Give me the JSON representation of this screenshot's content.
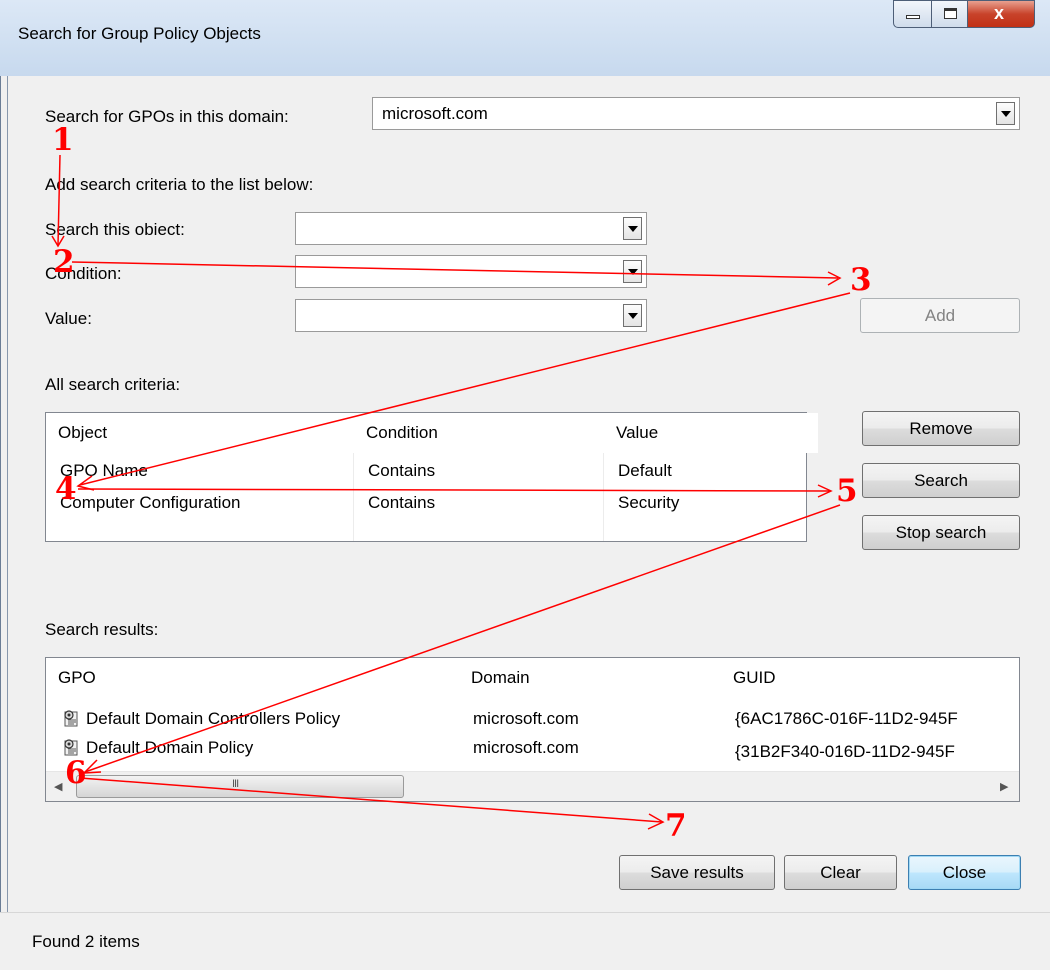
{
  "window": {
    "title": "Search for Group Policy Objects",
    "controls": [
      "minimize-icon",
      "maximize-icon",
      "close-icon"
    ]
  },
  "domain": {
    "label": "Search for GPOs in this domain:",
    "value": "microsoft.com"
  },
  "criteria_form": {
    "intro": "Add search criteria to the list below:",
    "object_label": "Search this obiect:",
    "object_value": "",
    "condition_label": "Condition:",
    "condition_value": "",
    "value_label": "Value:",
    "value_value": "",
    "add_button": "Add"
  },
  "criteria_list": {
    "label": "All search criteria:",
    "columns": [
      "Object",
      "Condition",
      "Value"
    ],
    "rows": [
      [
        "GPO Name",
        "Contains",
        "Default"
      ],
      [
        "Computer Configuration",
        "Contains",
        "Security"
      ]
    ]
  },
  "criteria_buttons": {
    "remove": "Remove",
    "search": "Search",
    "stop": "Stop search"
  },
  "results": {
    "label": "Search results:",
    "columns": [
      "GPO",
      "Domain",
      "GUID"
    ],
    "rows": [
      [
        "Default Domain Controllers Policy",
        "microsoft.com",
        "{6AC1786C-016F-11D2-945F"
      ],
      [
        "Default Domain Policy",
        "microsoft.com",
        "{31B2F340-016D-11D2-945F"
      ]
    ],
    "scrollbar_grip": "III"
  },
  "footer_buttons": {
    "save": "Save results",
    "clear": "Clear",
    "close": "Close"
  },
  "status": {
    "text": "Found 2 items"
  },
  "annotations": {
    "steps": [
      "1",
      "2",
      "3",
      "4",
      "5",
      "6",
      "7"
    ],
    "color": "#ff0000"
  }
}
